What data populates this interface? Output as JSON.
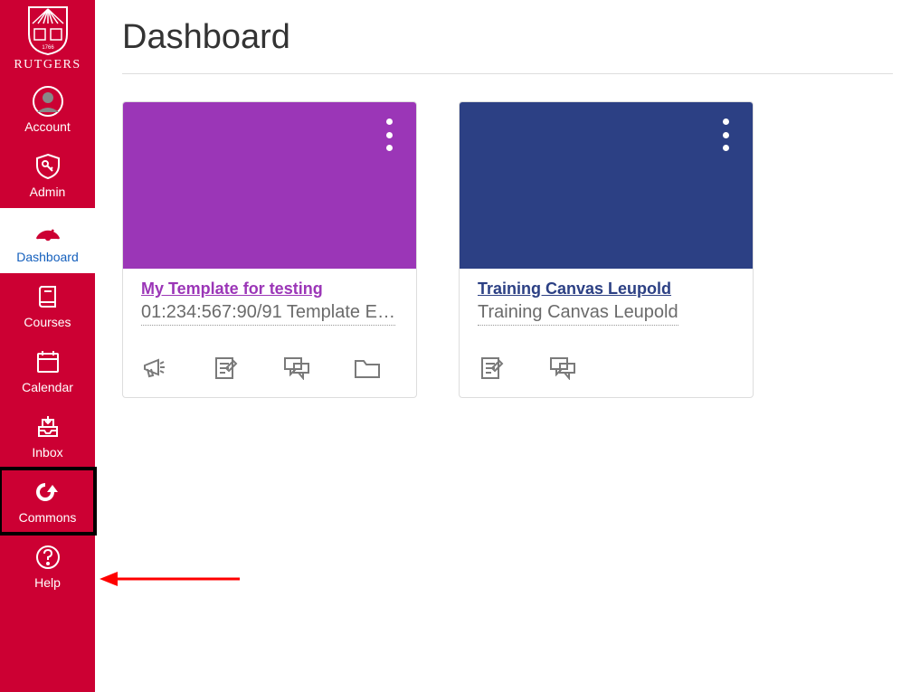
{
  "brand": {
    "name": "RUTGERS"
  },
  "sidebar": {
    "items": [
      {
        "id": "account",
        "label": "Account"
      },
      {
        "id": "admin",
        "label": "Admin"
      },
      {
        "id": "dashboard",
        "label": "Dashboard",
        "active": true
      },
      {
        "id": "courses",
        "label": "Courses"
      },
      {
        "id": "calendar",
        "label": "Calendar"
      },
      {
        "id": "inbox",
        "label": "Inbox"
      },
      {
        "id": "commons",
        "label": "Commons",
        "highlighted": true
      },
      {
        "id": "help",
        "label": "Help"
      }
    ]
  },
  "page": {
    "title": "Dashboard"
  },
  "cards": [
    {
      "title": "My Template for testing",
      "subtitle": "01:234:567:90/91 Template E…",
      "color": "#9b36b7",
      "title_color_class": "title-purple",
      "bg_class": "bg-purple",
      "actions": [
        "announcements",
        "assignments",
        "discussions",
        "files"
      ]
    },
    {
      "title": "Training Canvas Leupold",
      "subtitle": "Training Canvas Leupold",
      "color": "#2c4084",
      "title_color_class": "title-navy",
      "bg_class": "bg-navy",
      "actions": [
        "assignments",
        "discussions"
      ]
    }
  ],
  "annotations": {
    "arrow_target": "commons"
  }
}
